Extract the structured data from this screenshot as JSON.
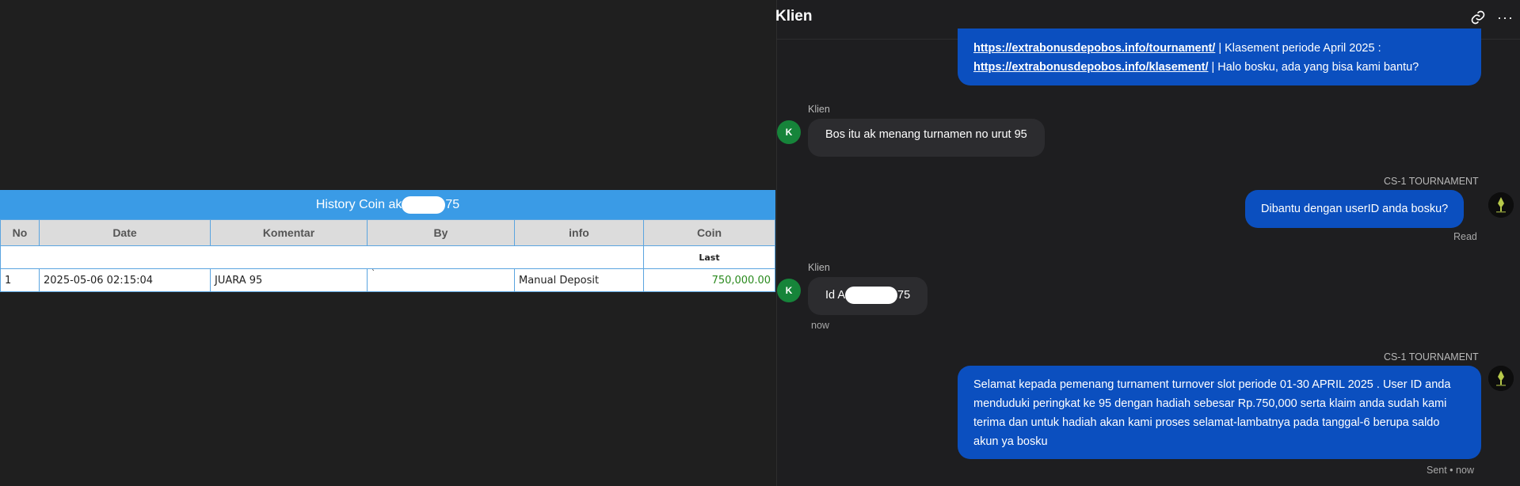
{
  "history": {
    "title_prefix": "History Coin ak",
    "title_suffix": "75",
    "columns": [
      "No",
      "Date",
      "Komentar",
      "By",
      "info",
      "Coin"
    ],
    "sub_header": "Last",
    "row": {
      "no": "1",
      "date": "2025-05-06 02:15:04",
      "komentar": "JUARA 95",
      "by": "`",
      "info": "Manual Deposit",
      "coin": "750,000.00"
    }
  },
  "chat": {
    "title": "Klien",
    "header_icons": [
      "link-icon",
      "more-icon"
    ],
    "more_glyph": "···",
    "msg1": {
      "link1": "https://extrabonusdepobos.info/tournament/",
      "text1": " | Klasement periode April 2025 :",
      "link2": "https://extrabonusdepobos.info/klasement/",
      "text2": " | Halo bosku, ada yang bisa kami bantu?"
    },
    "msg2": {
      "sender": "Klien",
      "avatar": "K",
      "text": "Bos itu ak menang turnamen no urut 95"
    },
    "msg3": {
      "sender": "CS-1 TOURNAMENT",
      "text": "Dibantu dengan userID anda bosku?",
      "status": "Read"
    },
    "msg4": {
      "sender": "Klien",
      "avatar": "K",
      "text_prefix": "Id A",
      "text_suffix": "75",
      "time": "now"
    },
    "msg5": {
      "sender": "CS-1 TOURNAMENT",
      "text": "Selamat kepada pemenang turnament turnover slot periode 01-30 APRIL 2025 . User ID anda menduduki peringkat ke 95 dengan hadiah sebesar Rp.750,000 serta klaim anda sudah kami terima dan untuk hadiah akan kami proses selamat-lambatnya pada tanggal-6 berupa saldo akun ya bosku",
      "status": "Sent • now"
    },
    "colors": {
      "outgoing": "#0b4fbf",
      "incoming": "#2c2c2f",
      "avatar": "#16843a",
      "table_header": "#3a9be6",
      "coin": "#2a8a1e"
    }
  }
}
